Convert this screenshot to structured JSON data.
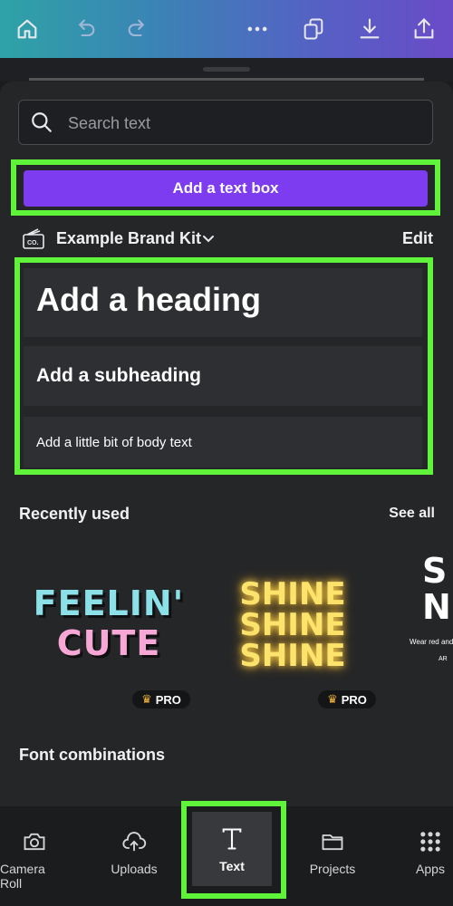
{
  "toolbar": {
    "home_icon": "home-icon",
    "undo_icon": "undo-icon",
    "redo_icon": "redo-icon",
    "more_icon": "more-icon",
    "pages_icon": "pages-icon",
    "download_icon": "download-icon",
    "share_icon": "share-icon"
  },
  "search": {
    "placeholder": "Search text"
  },
  "add_text_box": "Add a text box",
  "brand": {
    "kit_name": "Example Brand Kit",
    "edit": "Edit"
  },
  "text_styles": {
    "heading": "Add a heading",
    "subheading": "Add a subheading",
    "body": "Add a little bit of body text"
  },
  "recently_used": {
    "title": "Recently used",
    "see_all": "See all",
    "items": [
      {
        "line1": "FEELIN'",
        "line2": "CUTE",
        "badge": "PRO"
      },
      {
        "lines": [
          "SHINE",
          "SHINE",
          "SHINE"
        ],
        "badge": "PRO"
      },
      {
        "big": "S\nN",
        "small": "Wear red and",
        "small2": "AR"
      }
    ]
  },
  "font_combinations": {
    "title": "Font combinations"
  },
  "bottom_nav": [
    {
      "label": "Camera Roll",
      "icon": "camera-icon"
    },
    {
      "label": "Uploads",
      "icon": "upload-cloud-icon"
    },
    {
      "label": "Text",
      "icon": "text-icon",
      "active": true
    },
    {
      "label": "Projects",
      "icon": "folder-icon"
    },
    {
      "label": "Apps",
      "icon": "apps-grid-icon"
    }
  ],
  "colors": {
    "accent_purple": "#7d3cf0",
    "highlight_green": "#5ff43a",
    "background": "#252628"
  }
}
